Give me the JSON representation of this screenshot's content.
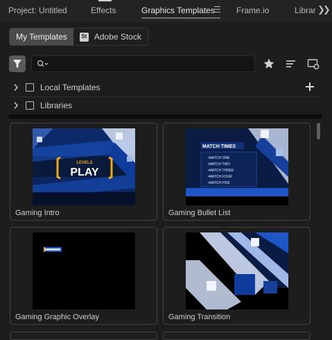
{
  "tabs": [
    {
      "label": "Project: Untitled"
    },
    {
      "label": "Effects"
    },
    {
      "label": "Graphics Templates"
    },
    {
      "label": "Frame.io"
    },
    {
      "label": "Librari"
    }
  ],
  "source_toggle": {
    "my_templates": "My Templates",
    "adobe_stock_badge": "St",
    "adobe_stock": "Adobe Stock"
  },
  "search": {
    "value": "",
    "placeholder": ""
  },
  "folders": [
    {
      "label": "Local Templates"
    },
    {
      "label": "Libraries"
    }
  ],
  "templates": [
    {
      "name": "Gaming Intro",
      "thumb_top_label": "LEVELS",
      "thumb_main_label": "PLAY"
    },
    {
      "name": "Gaming Bullet List",
      "thumb_title": "MATCH TIMES",
      "thumb_items": [
        "•MATCH ONE",
        "•MATCH TWO",
        "•MATCH THREE",
        "•MATCH FOUR",
        "•MATCH FIVE"
      ]
    },
    {
      "name": "Gaming Graphic Overlay"
    },
    {
      "name": "Gaming Transition"
    }
  ],
  "colors": {
    "accent": "#1e56c8",
    "panel_bg": "#1d1d1d",
    "tab_bar": "#232323",
    "card_border": "#444444"
  }
}
